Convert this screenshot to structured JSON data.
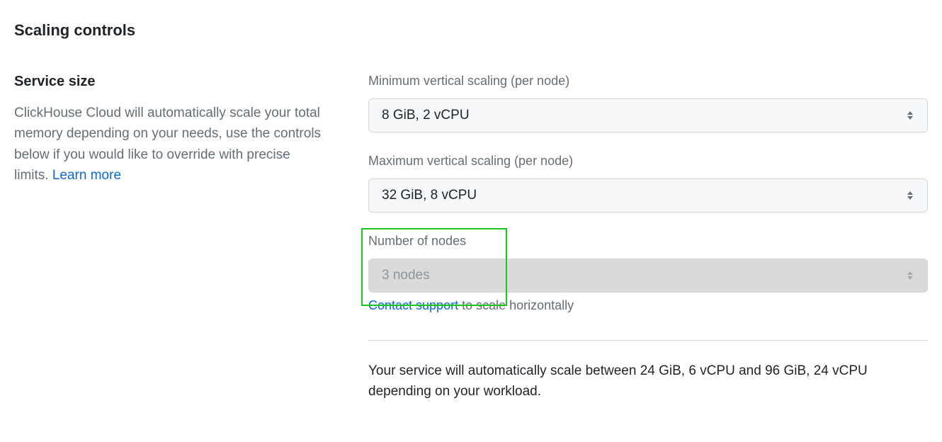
{
  "section_title": "Scaling controls",
  "left": {
    "subsection_title": "Service size",
    "description": "ClickHouse Cloud will automatically scale your total memory depending on your needs, use the controls below if you would like to override with precise limits.",
    "learn_more": "Learn more"
  },
  "fields": {
    "min_scaling": {
      "label": "Minimum vertical scaling (per node)",
      "value": "8 GiB, 2 vCPU"
    },
    "max_scaling": {
      "label": "Maximum vertical scaling (per node)",
      "value": "32 GiB, 8 vCPU"
    },
    "nodes": {
      "label": "Number of nodes",
      "value": "3 nodes"
    },
    "contact_support": "Contact support",
    "contact_suffix": " to scale horizontally"
  },
  "summary": "Your service will automatically scale between 24 GiB, 6 vCPU and 96 GiB, 24 vCPU depending on your workload."
}
